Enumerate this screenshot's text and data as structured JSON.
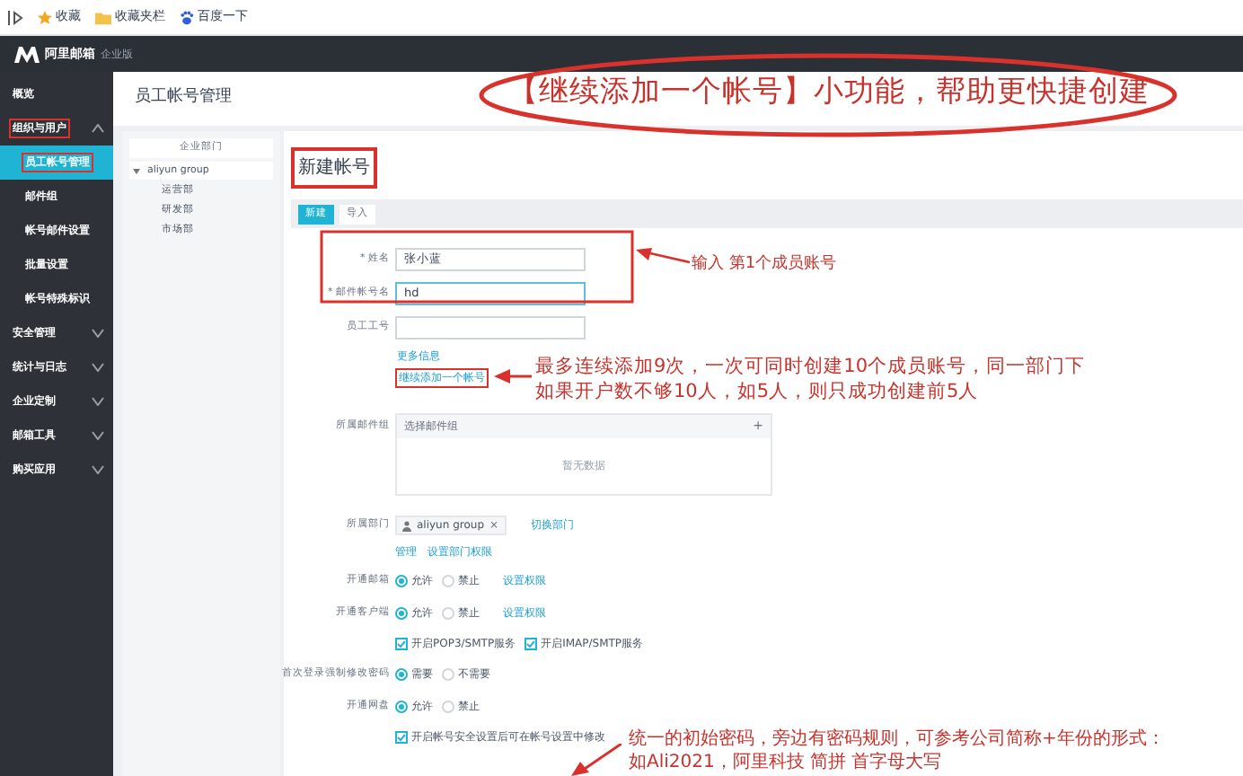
{
  "bookmarks": [
    {
      "kind": "star",
      "label": "收藏"
    },
    {
      "kind": "folder",
      "label": "收藏夹栏"
    },
    {
      "kind": "paw",
      "label": "百度一下"
    }
  ],
  "app": {
    "logo": "阿里邮箱",
    "edition": "企业版"
  },
  "sidebar": {
    "items": [
      {
        "label": "概览",
        "boxed": false
      },
      {
        "label": "组织与用户",
        "expanded": true,
        "boxed": true,
        "children": [
          {
            "label": "员工帐号管理",
            "selected": true,
            "boxed": true
          },
          {
            "label": "邮件组",
            "selected": false,
            "boxed": false
          },
          {
            "label": "帐号邮件设置",
            "selected": false,
            "boxed": false
          },
          {
            "label": "批量设置",
            "selected": false,
            "boxed": false
          },
          {
            "label": "帐号特殊标识",
            "selected": false,
            "boxed": false
          }
        ]
      },
      {
        "label": "安全管理",
        "expanded": false,
        "boxed": false
      },
      {
        "label": "统计与日志",
        "expanded": false,
        "boxed": false
      },
      {
        "label": "企业定制",
        "expanded": false,
        "boxed": false
      },
      {
        "label": "邮箱工具",
        "expanded": false,
        "boxed": false
      },
      {
        "label": "购买应用",
        "expanded": false,
        "boxed": false
      }
    ]
  },
  "page_title": "员工帐号管理",
  "tree": {
    "header": "企业部门",
    "root": {
      "label": "aliyun group",
      "expanded": true,
      "children": [
        {
          "label": "运营部"
        },
        {
          "label": "研发部"
        },
        {
          "label": "市场部"
        }
      ]
    }
  },
  "panel": {
    "heading": "新建帐号",
    "heading_boxed": true,
    "tabs": [
      {
        "label": "新建",
        "selected": true
      },
      {
        "label": "导入",
        "selected": false
      }
    ],
    "rows": [
      {
        "kind": "input",
        "label": "* 姓名",
        "value": "张小蓝",
        "focused": false
      },
      {
        "kind": "input",
        "label": "* 邮件帐号名",
        "value": "hd",
        "focused": true
      },
      {
        "kind": "input",
        "label": "员工工号",
        "focused": false
      },
      {
        "kind": "link",
        "text": "更多信息",
        "boxed": false
      },
      {
        "kind": "link",
        "text": "继续添加一个帐号",
        "boxed": true
      },
      {
        "kind": "group",
        "label": "所属邮件组",
        "header": "选择邮件组",
        "add": "+",
        "empty": "暂无数据"
      },
      {
        "kind": "department",
        "label": "所属部门",
        "chip": "aliyun group",
        "remove": "×",
        "link": "切换部门",
        "sublinks": [
          "管理",
          "设置部门权限"
        ]
      },
      {
        "kind": "radio",
        "label": "开通邮箱",
        "options": [
          {
            "label": "允许",
            "selected": true
          },
          {
            "label": "禁止",
            "selected": false
          }
        ],
        "link": "设置权限"
      },
      {
        "kind": "radio",
        "label": "开通客户端",
        "options": [
          {
            "label": "允许",
            "selected": true
          },
          {
            "label": "禁止",
            "selected": false
          }
        ],
        "link": "设置权限"
      },
      {
        "kind": "checkbox",
        "options": [
          {
            "label": "开启POP3/SMTP服务",
            "checked": true
          },
          {
            "label": "开启IMAP/SMTP服务",
            "checked": true
          }
        ]
      },
      {
        "kind": "radio",
        "label": "首次登录强制修改密码",
        "options": [
          {
            "label": "需要",
            "selected": true
          },
          {
            "label": "不需要",
            "selected": false
          }
        ]
      },
      {
        "kind": "radio",
        "label": "开通网盘",
        "options": [
          {
            "label": "允许",
            "selected": true
          },
          {
            "label": "禁止",
            "selected": false
          }
        ]
      },
      {
        "kind": "checkbox",
        "options": [
          {
            "label": "开启帐号安全设置后可在帐号设置中修改",
            "checked": true
          }
        ]
      }
    ]
  },
  "annotations": {
    "title": "【继续添加一个帐号】小功能，帮助更快捷创建",
    "input_note": "输入 第1个成员账号",
    "repeat_note": [
      "最多连续添加9次，一次可同时创建10个成员账号，同一部门下",
      "如果开户数不够10人，如5人，则只成功创建前5人"
    ],
    "password_note": [
      "统一的初始密码，旁边有密码规则，可参考公司简称+年份的形式：",
      "如Ali2021，阿里科技 简拼 首字母大写"
    ]
  }
}
